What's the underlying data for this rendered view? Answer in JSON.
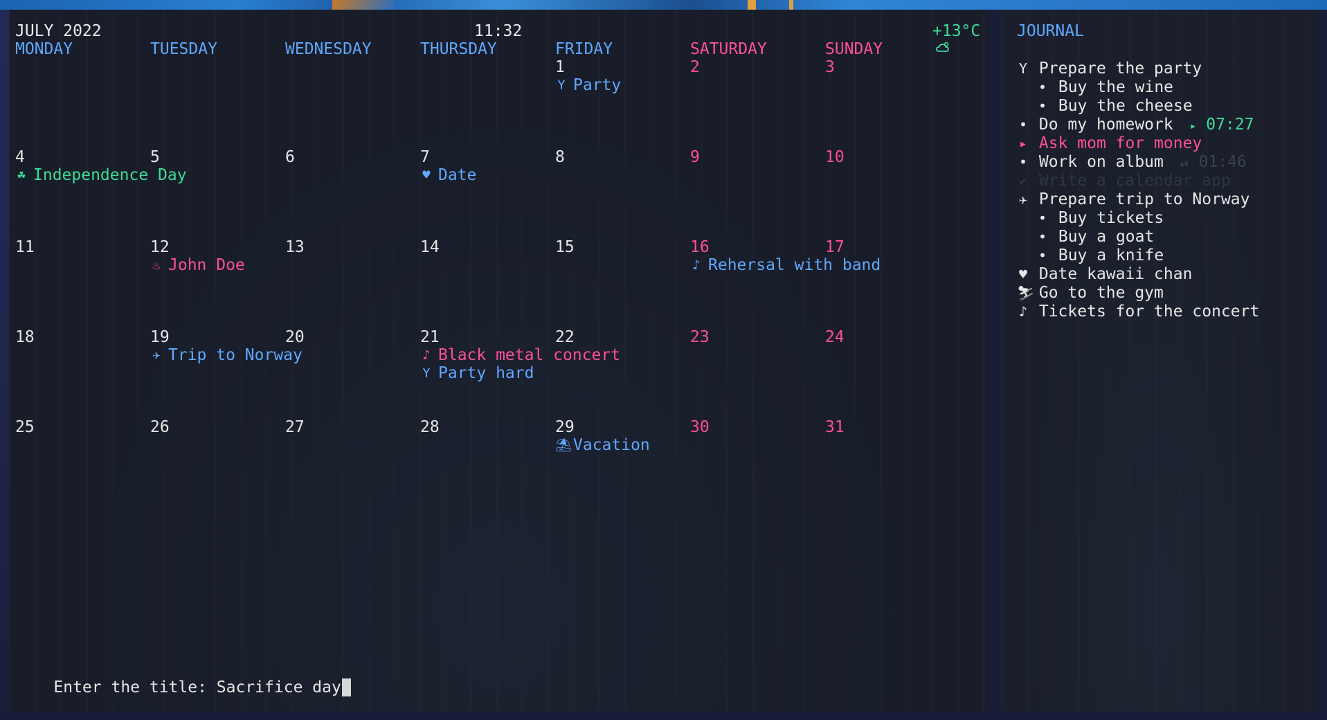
{
  "calendar": {
    "month_title": "JULY 2022",
    "clock": "11:32",
    "weather_icon": "cloud-sun-icon",
    "temperature": "+13°C",
    "day_names": [
      "MONDAY",
      "TUESDAY",
      "WEDNESDAY",
      "THURSDAY",
      "FRIDAY",
      "SATURDAY",
      "SUNDAY"
    ],
    "weeks": [
      [
        {
          "day": "",
          "events": []
        },
        {
          "day": "",
          "events": []
        },
        {
          "day": "",
          "events": []
        },
        {
          "day": "",
          "events": []
        },
        {
          "day": "1",
          "events": [
            {
              "icon": "cocktail-icon",
              "glyph": "Y",
              "label": "Party",
              "color": "blue"
            }
          ]
        },
        {
          "day": "2",
          "events": []
        },
        {
          "day": "3",
          "events": []
        }
      ],
      [
        {
          "day": "4",
          "events": [
            {
              "icon": "shamrock-icon",
              "glyph": "☘",
              "label": "Independence Day",
              "color": "green"
            }
          ]
        },
        {
          "day": "5",
          "events": []
        },
        {
          "day": "6",
          "events": []
        },
        {
          "day": "7",
          "events": [
            {
              "icon": "heart-icon",
              "glyph": "♥",
              "label": "Date",
              "color": "blue"
            }
          ]
        },
        {
          "day": "8",
          "events": []
        },
        {
          "day": "9",
          "events": []
        },
        {
          "day": "10",
          "events": []
        }
      ],
      [
        {
          "day": "11",
          "events": []
        },
        {
          "day": "12",
          "events": [
            {
              "icon": "birthday-cake-icon",
              "glyph": "♨",
              "label": "John Doe",
              "color": "pink"
            }
          ]
        },
        {
          "day": "13",
          "events": []
        },
        {
          "day": "14",
          "events": []
        },
        {
          "day": "15",
          "events": []
        },
        {
          "day": "16",
          "events": [
            {
              "icon": "music-note-icon",
              "glyph": "♪",
              "label": "Rehersal with band",
              "color": "blue"
            }
          ]
        },
        {
          "day": "17",
          "events": []
        }
      ],
      [
        {
          "day": "18",
          "events": []
        },
        {
          "day": "19",
          "events": [
            {
              "icon": "airplane-icon",
              "glyph": "✈",
              "label": "Trip to Norway",
              "color": "blue"
            }
          ]
        },
        {
          "day": "20",
          "events": []
        },
        {
          "day": "21",
          "events": [
            {
              "icon": "music-note-icon",
              "glyph": "♪",
              "label": "Black metal concert",
              "color": "pink"
            },
            {
              "icon": "cocktail-icon",
              "glyph": "Y",
              "label": "Party hard",
              "color": "blue"
            }
          ]
        },
        {
          "day": "22",
          "events": []
        },
        {
          "day": "23",
          "events": []
        },
        {
          "day": "24",
          "events": []
        }
      ],
      [
        {
          "day": "25",
          "events": []
        },
        {
          "day": "26",
          "events": []
        },
        {
          "day": "27",
          "events": []
        },
        {
          "day": "28",
          "events": []
        },
        {
          "day": "29",
          "events": [
            {
              "icon": "beach-umbrella-icon",
              "glyph": "⛱",
              "label": "Vacation",
              "color": "blue"
            }
          ]
        },
        {
          "day": "30",
          "events": []
        },
        {
          "day": "31",
          "events": []
        }
      ]
    ],
    "prompt": {
      "label": "Enter the title: ",
      "value": "Sacrifice day"
    }
  },
  "journal": {
    "title": "JOURNAL",
    "items": [
      {
        "level": 0,
        "icon": "cocktail-icon",
        "glyph": "Y",
        "text": "Prepare the party",
        "style": "normal",
        "timer": ""
      },
      {
        "level": 1,
        "icon": "bullet-icon",
        "glyph": "•",
        "text": "Buy the wine",
        "style": "normal",
        "timer": ""
      },
      {
        "level": 1,
        "icon": "bullet-icon",
        "glyph": "•",
        "text": "Buy the cheese",
        "style": "normal",
        "timer": ""
      },
      {
        "level": 0,
        "icon": "bullet-icon",
        "glyph": "•",
        "text": "Do my homework",
        "style": "normal",
        "timer": "07:27",
        "timer_icon": "play-icon",
        "timer_glyph": "▸",
        "timer_style": "green"
      },
      {
        "level": 0,
        "icon": "triangle-right-icon",
        "glyph": "▸",
        "text": "Ask mom for money",
        "style": "pink",
        "timer": ""
      },
      {
        "level": 0,
        "icon": "bullet-icon",
        "glyph": "•",
        "text": "Work on album",
        "style": "normal",
        "timer": "01:46",
        "timer_icon": "pause-icon",
        "timer_glyph": "⏯",
        "timer_style": "dim"
      },
      {
        "level": 0,
        "icon": "checkmark-icon",
        "glyph": "✔",
        "text": "Write a calendar app",
        "style": "faint",
        "timer": ""
      },
      {
        "level": 0,
        "icon": "airplane-icon",
        "glyph": "✈",
        "text": "Prepare trip to Norway",
        "style": "normal",
        "timer": ""
      },
      {
        "level": 1,
        "icon": "bullet-icon",
        "glyph": "•",
        "text": "Buy tickets",
        "style": "normal",
        "timer": ""
      },
      {
        "level": 1,
        "icon": "bullet-icon",
        "glyph": "•",
        "text": "Buy a goat",
        "style": "normal",
        "timer": ""
      },
      {
        "level": 1,
        "icon": "bullet-icon",
        "glyph": "•",
        "text": "Buy a knife",
        "style": "normal",
        "timer": ""
      },
      {
        "level": 0,
        "icon": "heart-icon",
        "glyph": "♥",
        "text": "Date kawaii chan",
        "style": "normal",
        "timer": ""
      },
      {
        "level": 0,
        "icon": "running-person-icon",
        "glyph": "⛷",
        "text": "Go to the gym",
        "style": "normal",
        "timer": ""
      },
      {
        "level": 0,
        "icon": "music-note-icon",
        "glyph": "♪",
        "text": "Tickets for the concert",
        "style": "normal",
        "timer": ""
      }
    ]
  },
  "colors": {
    "blue": "#5fa8ff",
    "green": "#3ddc97",
    "pink": "#ff4f9a",
    "panel_bg": "#181d29",
    "text": "#e6e6e6"
  }
}
